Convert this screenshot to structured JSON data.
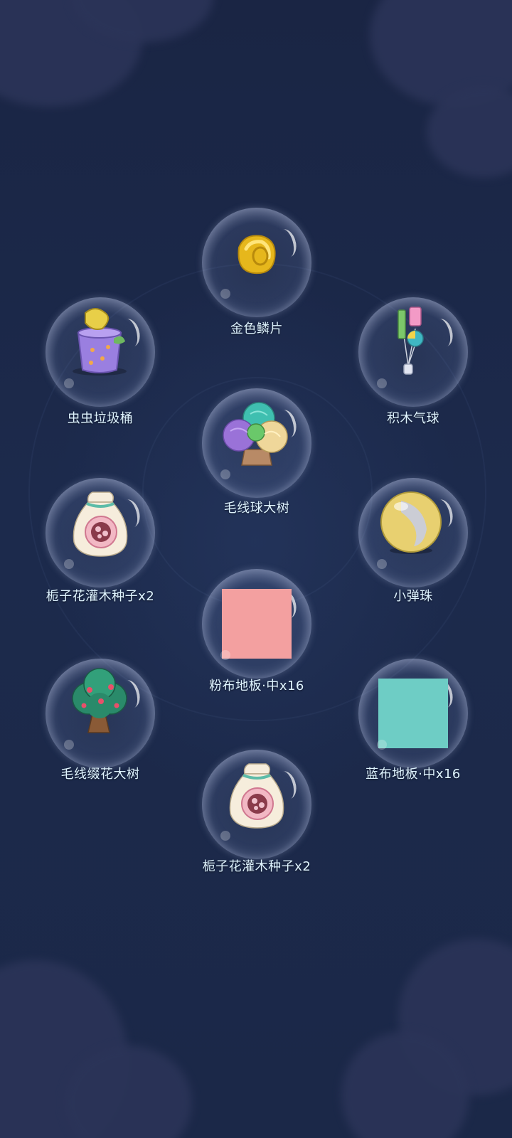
{
  "rewards": [
    {
      "name": "金色鳞片",
      "icon": "gold-scale-icon"
    },
    {
      "name": "虫虫垃圾桶",
      "icon": "bug-trash-can-icon"
    },
    {
      "name": "积木气球",
      "icon": "block-balloon-icon"
    },
    {
      "name": "毛线球大树",
      "icon": "yarn-ball-tree-icon"
    },
    {
      "name": "栀子花灌木种子x2",
      "icon": "seed-bag-icon"
    },
    {
      "name": "小弹珠",
      "icon": "marble-icon"
    },
    {
      "name": "粉布地板·中x16",
      "icon": "pink-floor-swatch",
      "color": "#f3a0a0"
    },
    {
      "name": "毛线缀花大树",
      "icon": "yarn-flower-tree-icon"
    },
    {
      "name": "蓝布地板·中x16",
      "icon": "blue-floor-swatch",
      "color": "#6ecdc5"
    },
    {
      "name": "栀子花灌木种子x2",
      "icon": "seed-bag-icon"
    }
  ]
}
